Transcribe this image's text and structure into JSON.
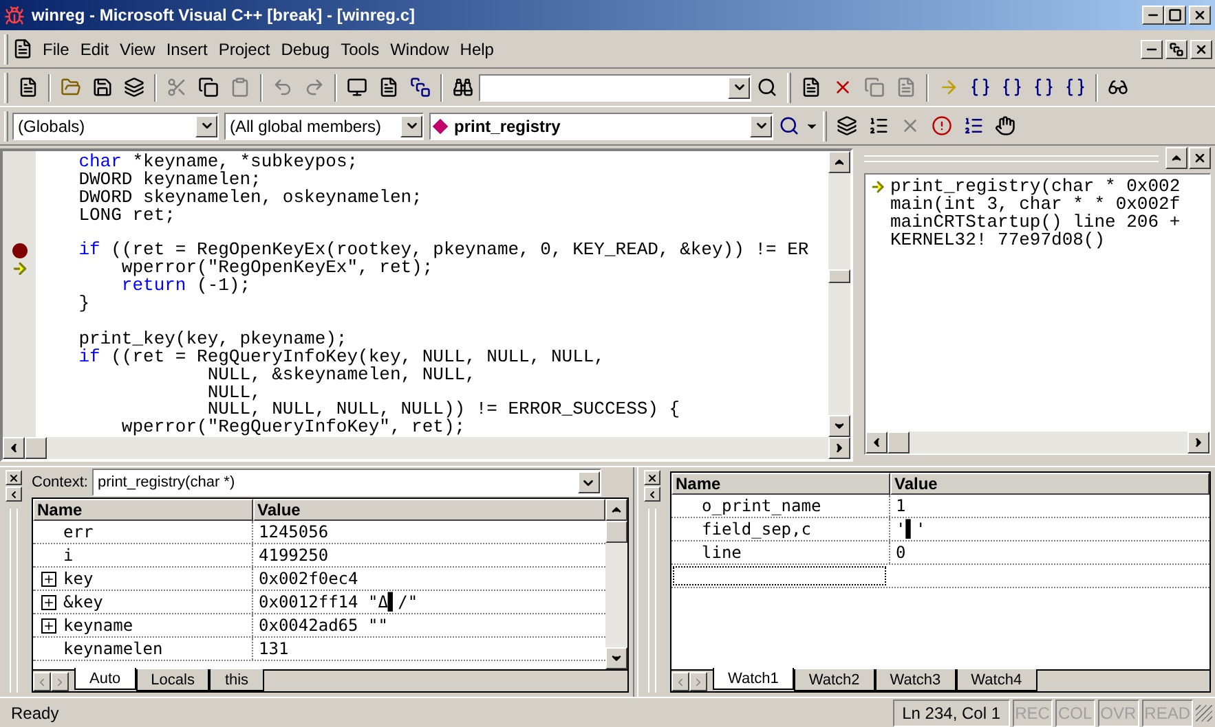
{
  "window": {
    "title": "winreg - Microsoft Visual C++ [break] - [winreg.c]"
  },
  "menu": [
    "File",
    "Edit",
    "View",
    "Insert",
    "Project",
    "Debug",
    "Tools",
    "Window",
    "Help"
  ],
  "wizard_bar": {
    "scope": "(Globals)",
    "filter": "(All global members)",
    "member": "print_registry"
  },
  "editor": {
    "lines": [
      {
        "breakpoint": false,
        "current": false,
        "segments": [
          {
            "text": "    char",
            "kind": "keyword"
          },
          {
            "text": " *keyname, *subkeypos;",
            "kind": "plain"
          }
        ]
      },
      {
        "breakpoint": false,
        "current": false,
        "segments": [
          {
            "text": "    DWORD keynamelen;",
            "kind": "plain"
          }
        ]
      },
      {
        "breakpoint": false,
        "current": false,
        "segments": [
          {
            "text": "    DWORD skeynamelen, oskeynamelen;",
            "kind": "plain"
          }
        ]
      },
      {
        "breakpoint": false,
        "current": false,
        "segments": [
          {
            "text": "    LONG ret;",
            "kind": "plain"
          }
        ]
      },
      {
        "breakpoint": false,
        "current": false
      },
      {
        "breakpoint": true,
        "current": false,
        "segments": [
          {
            "text": "    if",
            "kind": "keyword"
          },
          {
            "text": " ((ret = RegOpenKeyEx(rootkey, pkeyname, 0, KEY_READ, &key)) != ER",
            "kind": "plain"
          }
        ]
      },
      {
        "breakpoint": false,
        "current": true,
        "segments": [
          {
            "text": "        wperror(\"RegOpenKeyEx\", ret);",
            "kind": "plain"
          }
        ]
      },
      {
        "breakpoint": false,
        "current": false,
        "segments": [
          {
            "text": "        return",
            "kind": "keyword"
          },
          {
            "text": " (-1);",
            "kind": "plain"
          }
        ]
      },
      {
        "breakpoint": false,
        "current": false,
        "segments": [
          {
            "text": "    }",
            "kind": "plain"
          }
        ]
      },
      {
        "breakpoint": false,
        "current": false
      },
      {
        "breakpoint": false,
        "current": false,
        "segments": [
          {
            "text": "    print_key(key, pkeyname);",
            "kind": "plain"
          }
        ]
      },
      {
        "breakpoint": false,
        "current": false,
        "segments": [
          {
            "text": "    if",
            "kind": "keyword"
          },
          {
            "text": " ((ret = RegQueryInfoKey(key, NULL, NULL, NULL,",
            "kind": "plain"
          }
        ]
      },
      {
        "breakpoint": false,
        "current": false,
        "segments": [
          {
            "text": "                NULL, &skeynamelen, NULL,",
            "kind": "plain"
          }
        ]
      },
      {
        "breakpoint": false,
        "current": false,
        "segments": [
          {
            "text": "                NULL,",
            "kind": "plain"
          }
        ]
      },
      {
        "breakpoint": false,
        "current": false,
        "segments": [
          {
            "text": "                NULL, NULL, NULL, NULL)) != ERROR_SUCCESS) {",
            "kind": "plain"
          }
        ]
      },
      {
        "breakpoint": false,
        "current": false,
        "segments": [
          {
            "text": "        wperror(\"RegQueryInfoKey\", ret);",
            "kind": "plain"
          }
        ]
      }
    ]
  },
  "call_stack": [
    {
      "text": "print_registry(char * 0x002",
      "current": true
    },
    {
      "text": "main(int 3, char * * 0x002f",
      "current": false
    },
    {
      "text": "mainCRTStartup() line 206 +",
      "current": false
    },
    {
      "text": "KERNEL32! 77e97d08()",
      "current": false
    }
  ],
  "variables": {
    "context_label": "Context:",
    "context": "print_registry(char *)",
    "columns": [
      "Name",
      "Value"
    ],
    "rows": [
      {
        "name": "err",
        "value": "1245056",
        "expandable": false
      },
      {
        "name": "i",
        "value": "4199250",
        "expandable": false
      },
      {
        "name": "key",
        "value": "0x002f0ec4",
        "expandable": true
      },
      {
        "name": "&key",
        "value": "0x0012ff14 \"Δ▌/\"",
        "expandable": true
      },
      {
        "name": "keyname",
        "value": "0x0042ad65 \"\"",
        "expandable": true
      },
      {
        "name": "keynamelen",
        "value": "131",
        "expandable": false
      }
    ],
    "tabs": [
      {
        "label": "Auto",
        "selected": true
      },
      {
        "label": "Locals",
        "selected": false
      },
      {
        "label": "this",
        "selected": false
      }
    ]
  },
  "watch": {
    "columns": [
      "Name",
      "Value"
    ],
    "rows": [
      {
        "name": "o_print_name",
        "value": "1"
      },
      {
        "name": "field_sep,c",
        "value": "'▌'"
      },
      {
        "name": "line",
        "value": "0"
      }
    ],
    "tabs": [
      {
        "label": "Watch1",
        "selected": true
      },
      {
        "label": "Watch2",
        "selected": false
      },
      {
        "label": "Watch3",
        "selected": false
      },
      {
        "label": "Watch4",
        "selected": false
      }
    ]
  },
  "status_bar": {
    "message": "Ready",
    "position": "Ln 234, Col 1",
    "indicators": [
      {
        "label": "REC",
        "disabled": true
      },
      {
        "label": "COL",
        "disabled": true
      },
      {
        "label": "OVR",
        "disabled": true
      },
      {
        "label": "READ",
        "disabled": true
      }
    ]
  }
}
